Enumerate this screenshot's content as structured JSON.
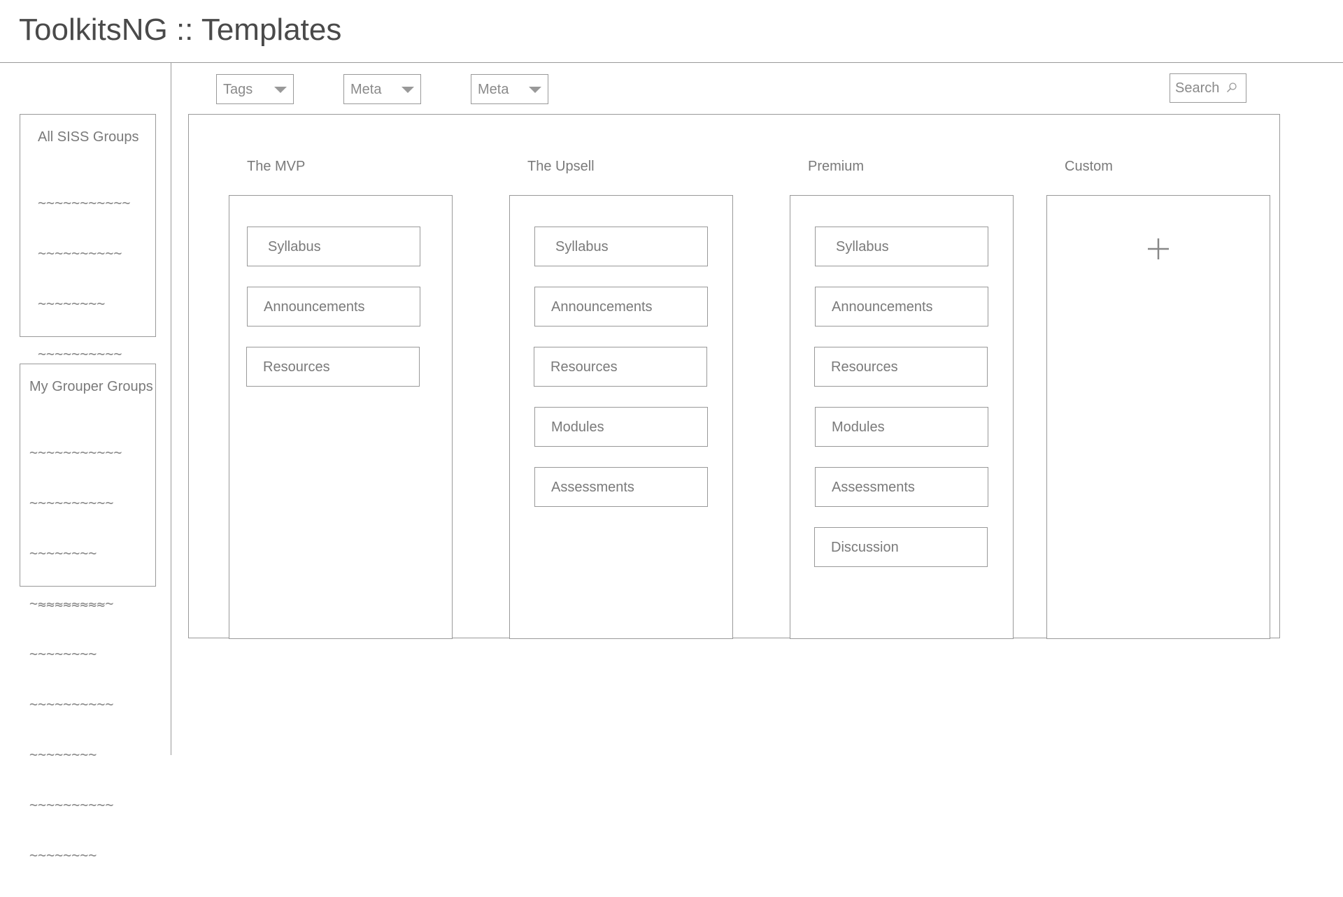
{
  "header": {
    "title": "ToolkitsNG :: Templates"
  },
  "sidebar": {
    "all_siss": {
      "title": "All SISS Groups",
      "lines": [
        "~~~~~~~~~~~",
        "~~~~~~~~~~",
        "~~~~~~~~",
        "~~~~~~~~~~",
        "~~~~~~~~",
        "~~~~~~~~~~",
        "~~~~~~~~",
        "~~~~~~~~~~",
        "~~~~~~~~"
      ]
    },
    "my_grouper": {
      "title": "My Grouper Groups",
      "lines": [
        "~~~~~~~~~~~",
        "~~~~~~~~~~",
        "~~~~~~~~",
        "~~~~~~~~~~",
        "~~~~~~~~",
        "~~~~~~~~~~",
        "~~~~~~~~",
        "~~~~~~~~~~",
        "~~~~~~~~"
      ]
    }
  },
  "filters": {
    "tags": "Tags",
    "meta1": "Meta",
    "meta2": "Meta",
    "search_label": "Search",
    "search_icon": "search-icon",
    "dropdown_icon": "triangle-down-icon"
  },
  "templates": [
    {
      "title": "The MVP",
      "items": [
        "Syllabus",
        "Announcements",
        "Resources"
      ]
    },
    {
      "title": "The Upsell",
      "items": [
        "Syllabus",
        "Announcements",
        "Resources",
        "Modules",
        "Assessments"
      ]
    },
    {
      "title": "Premium",
      "items": [
        "Syllabus",
        "Announcements",
        "Resources",
        "Modules",
        "Assessments",
        "Discussion"
      ]
    },
    {
      "title": "Custom",
      "items": [],
      "add_icon": "plus-icon"
    }
  ],
  "colors": {
    "border": "#999999",
    "text": "#7a7a7a",
    "title": "#4a4a4a",
    "background": "#ffffff"
  }
}
